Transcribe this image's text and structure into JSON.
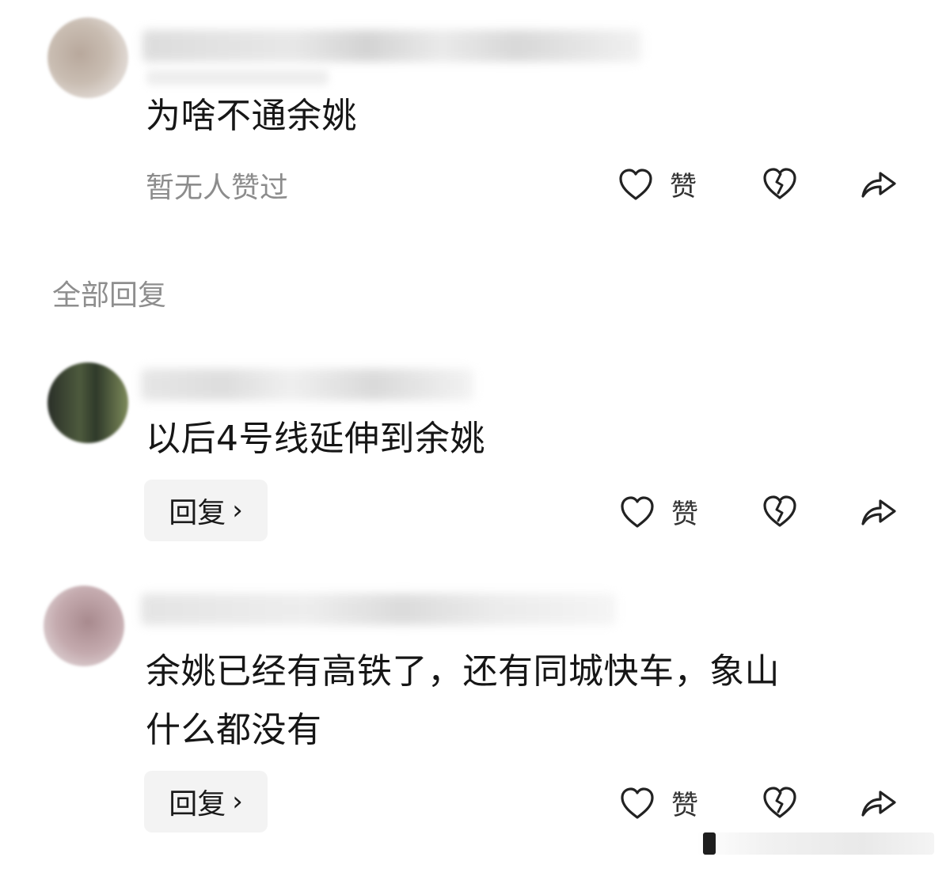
{
  "comments_top": {
    "text": "为啥不通余姚",
    "like_status": "暂无人赞过",
    "like_label": "赞"
  },
  "section": {
    "title": "全部回复"
  },
  "replies": [
    {
      "text": "以后4号线延伸到余姚",
      "reply_label": "回复",
      "reply_chevron": "›",
      "like_label": "赞"
    },
    {
      "text": "余姚已经有高铁了，还有同城快车，象山\n什么都没有",
      "reply_label": "回复",
      "reply_chevron": "›",
      "like_label": "赞"
    }
  ],
  "icons": {
    "like": "heart-outline-icon",
    "dislike": "broken-heart-icon",
    "share": "share-arrow-icon"
  }
}
